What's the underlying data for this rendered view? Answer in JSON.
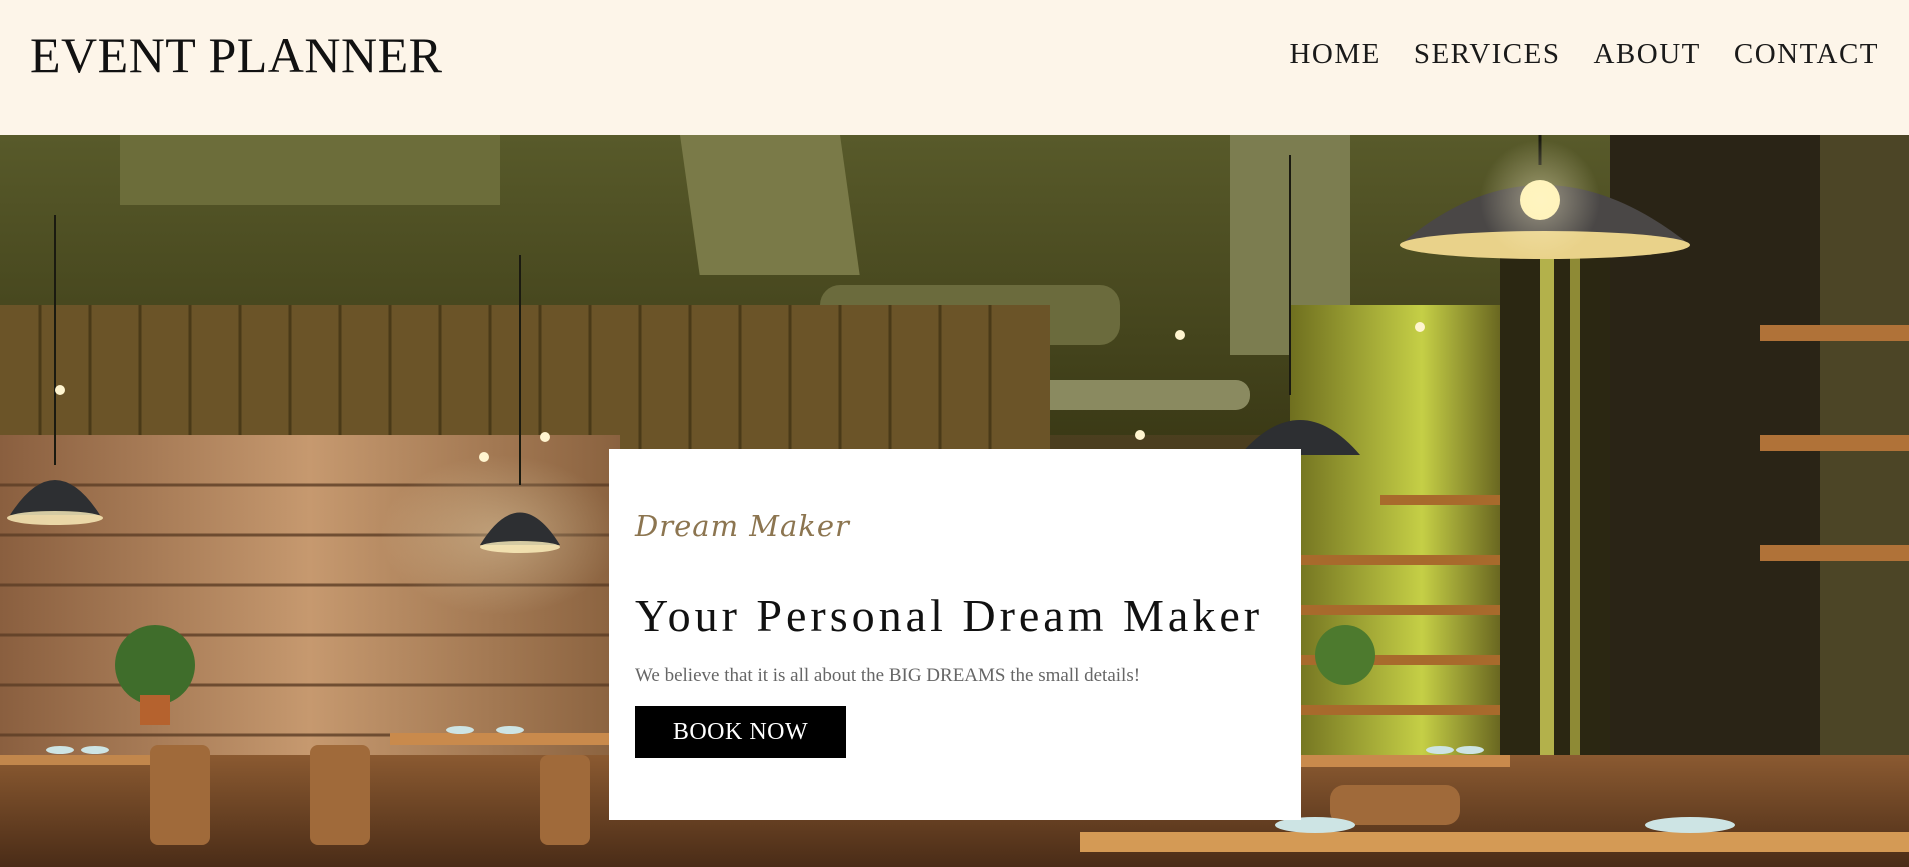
{
  "header": {
    "brand": "EVENT PLANNER",
    "nav": [
      "HOME",
      "SERVICES",
      "ABOUT",
      "CONTACT"
    ]
  },
  "hero": {
    "script_title": "Dream Maker",
    "headline": "Your Personal Dream Maker",
    "tagline": "We believe that it is all about the BIG DREAMS the small details!",
    "cta_label": "BOOK NOW",
    "background_description_colors": {
      "ceiling": "#4a4a1c",
      "wall": "#a27652",
      "floor": "#7a4e2c",
      "accent_light": "#d8e066"
    }
  }
}
